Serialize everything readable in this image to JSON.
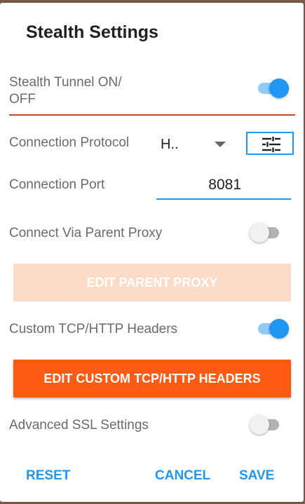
{
  "dialog": {
    "title": "Stealth Settings"
  },
  "stealth_tunnel": {
    "label_line1": "Stealth Tunnel ON/",
    "label_line2": "OFF",
    "enabled": true
  },
  "connection_protocol": {
    "label": "Connection Protocol",
    "selected_value": "H..",
    "settings_icon": "tune-icon"
  },
  "connection_port": {
    "label": "Connection Port",
    "value": "8081"
  },
  "parent_proxy": {
    "label": "Connect Via Parent Proxy",
    "enabled": false,
    "edit_button_label": "EDIT PARENT PROXY",
    "edit_button_enabled": false
  },
  "custom_headers": {
    "label": "Custom TCP/HTTP Headers",
    "enabled": true,
    "edit_button_label": "EDIT CUSTOM TCP/HTTP HEADERS"
  },
  "advanced_ssl": {
    "label": "Advanced SSL Settings",
    "enabled": false
  },
  "actions": {
    "reset": "RESET",
    "cancel": "CANCEL",
    "save": "SAVE"
  },
  "colors": {
    "accent_blue": "#2196f3",
    "primary_orange": "#fe5b14",
    "disabled_orange": "#fcdcc8",
    "divider_red": "#c44a2a"
  }
}
